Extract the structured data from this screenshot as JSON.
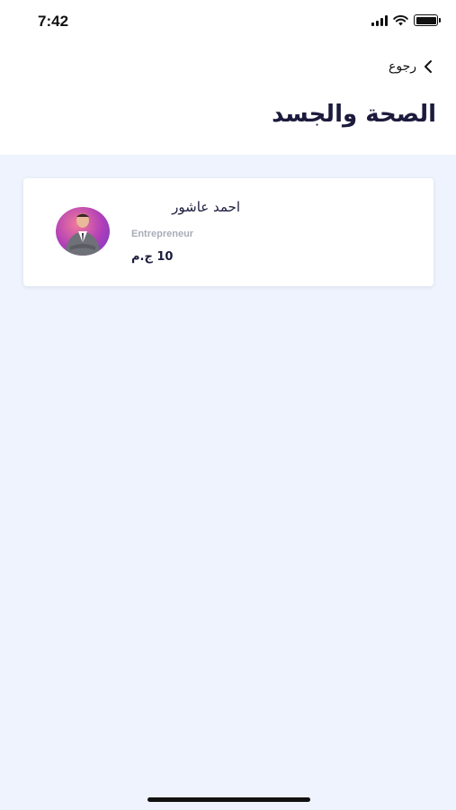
{
  "status_bar": {
    "time": "7:42"
  },
  "header": {
    "back_label": "رجوع",
    "title": "الصحة والجسد"
  },
  "instructor_card": {
    "name": "احمد عاشور",
    "role": "Entrepreneur",
    "price": "10 ج.م",
    "avatar_icon": "person-avatar-photo",
    "colors": {
      "avatar_gradient_start": "#f07a9a",
      "avatar_gradient_end": "#6b3bc9"
    }
  },
  "colors": {
    "title": "#1c1b3d",
    "background": "#eef3fd",
    "card": "#ffffff",
    "muted": "#a9adb8"
  }
}
